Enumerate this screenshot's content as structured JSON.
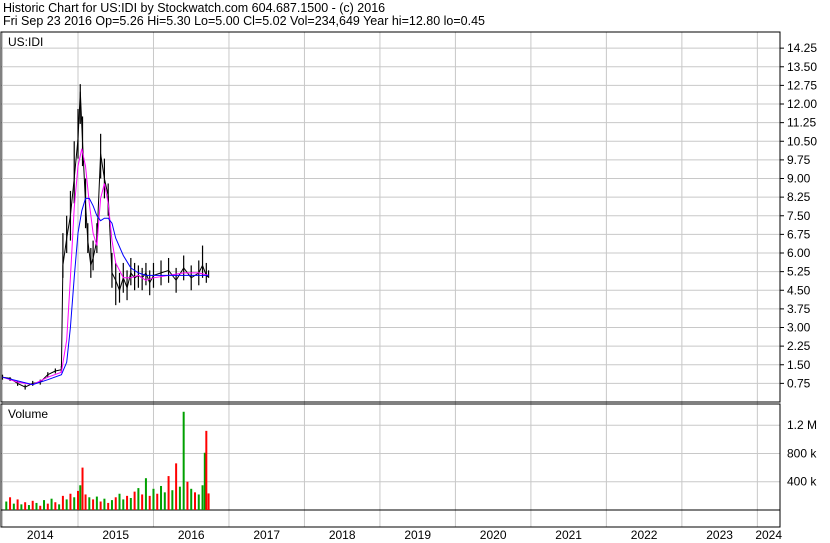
{
  "header": {
    "line1": "Historic Chart for US:IDI by Stockwatch.com 604.687.1500 - (c) 2016",
    "line2": "Fri Sep 23 2016   Op=5.26  Hi=5.30  Lo=5.00  Cl=5.02  Vol=234,649  Year hi=12.80  lo=0.45"
  },
  "chart_data": {
    "type": "line",
    "symbol_label": "US:IDI",
    "volume_label": "Volume",
    "price_axis": {
      "ticks": [
        "14.25",
        "13.50",
        "12.75",
        "12.00",
        "11.25",
        "10.50",
        "9.75",
        "9.00",
        "8.25",
        "7.50",
        "6.75",
        "6.00",
        "5.25",
        "4.50",
        "3.75",
        "3.00",
        "2.25",
        "1.50",
        "0.75"
      ],
      "ylim": [
        0.0,
        14.9
      ]
    },
    "volume_axis": {
      "ticks": [
        "1.2 M",
        "800 k",
        "400 k"
      ],
      "ylim": [
        0,
        1500000
      ]
    },
    "x_axis": {
      "labels": [
        "2014",
        "2015",
        "2016",
        "2017",
        "2018",
        "2019",
        "2020",
        "2021",
        "2022",
        "2023",
        "2024"
      ],
      "xlim": [
        2013.98,
        2024.3
      ]
    },
    "series": [
      {
        "color": "#000000",
        "x": [
          2014.0,
          2014.1,
          2014.2,
          2014.3,
          2014.4,
          2014.5,
          2014.6,
          2014.7,
          2014.78,
          2014.8,
          2014.85,
          2014.9,
          2014.95,
          2015.0,
          2015.03,
          2015.06,
          2015.1,
          2015.13,
          2015.17,
          2015.2,
          2015.25,
          2015.3,
          2015.35,
          2015.4,
          2015.45,
          2015.5,
          2015.55,
          2015.6,
          2015.65,
          2015.7,
          2015.75,
          2015.8,
          2015.85,
          2015.9,
          2015.95,
          2016.0,
          2016.1,
          2016.2,
          2016.3,
          2016.4,
          2016.5,
          2016.6,
          2016.65,
          2016.7,
          2016.73
        ],
        "close": [
          1.0,
          0.95,
          0.75,
          0.6,
          0.75,
          0.8,
          1.1,
          1.25,
          1.3,
          5.5,
          6.6,
          7.5,
          9.0,
          10.6,
          12.5,
          10.5,
          8.0,
          6.5,
          5.5,
          5.8,
          6.5,
          10.0,
          9.0,
          8.3,
          5.2,
          4.9,
          4.5,
          5.0,
          4.6,
          5.2,
          5.0,
          5.1,
          5.0,
          5.2,
          4.8,
          5.1,
          5.2,
          5.3,
          4.9,
          5.4,
          5.0,
          5.2,
          5.5,
          5.1,
          5.02
        ],
        "high": [
          1.1,
          1.0,
          0.85,
          0.7,
          0.85,
          0.9,
          1.2,
          1.35,
          1.45,
          6.8,
          7.5,
          8.5,
          10.5,
          11.8,
          12.8,
          11.5,
          9.0,
          7.2,
          6.2,
          6.5,
          7.2,
          10.8,
          9.8,
          8.8,
          6.0,
          5.6,
          5.2,
          5.6,
          5.3,
          5.8,
          5.6,
          5.5,
          5.4,
          5.6,
          5.3,
          5.6,
          5.7,
          5.8,
          5.4,
          5.9,
          5.5,
          5.7,
          6.3,
          5.6,
          5.3
        ],
        "low": [
          0.9,
          0.85,
          0.65,
          0.5,
          0.65,
          0.7,
          1.0,
          1.15,
          1.2,
          5.0,
          6.0,
          6.5,
          8.0,
          9.8,
          11.2,
          9.5,
          7.0,
          6.0,
          5.0,
          5.3,
          6.0,
          9.0,
          8.2,
          7.5,
          4.6,
          3.9,
          4.0,
          4.4,
          4.1,
          4.7,
          4.5,
          4.6,
          4.5,
          4.7,
          4.3,
          4.6,
          4.7,
          4.8,
          4.4,
          4.9,
          4.5,
          4.7,
          5.0,
          4.8,
          5.0
        ]
      },
      {
        "color": "#ff00ff",
        "x": [
          2014.0,
          2014.2,
          2014.4,
          2014.6,
          2014.78,
          2014.85,
          2014.9,
          2014.95,
          2015.0,
          2015.05,
          2015.1,
          2015.15,
          2015.2,
          2015.25,
          2015.3,
          2015.35,
          2015.4,
          2015.45,
          2015.5,
          2015.6,
          2015.7,
          2015.8,
          2015.9,
          2016.0,
          2016.2,
          2016.4,
          2016.6,
          2016.73
        ],
        "y": [
          1.0,
          0.8,
          0.7,
          1.0,
          1.2,
          2.5,
          5.0,
          7.8,
          9.5,
          10.2,
          9.5,
          8.0,
          6.8,
          6.3,
          8.2,
          8.8,
          8.0,
          6.5,
          5.6,
          5.0,
          5.0,
          5.1,
          4.9,
          5.0,
          5.1,
          5.2,
          5.2,
          5.1
        ]
      },
      {
        "color": "#0000ff",
        "x": [
          2014.0,
          2014.2,
          2014.4,
          2014.6,
          2014.78,
          2014.85,
          2014.9,
          2014.95,
          2015.0,
          2015.05,
          2015.1,
          2015.15,
          2015.2,
          2015.25,
          2015.3,
          2015.35,
          2015.4,
          2015.45,
          2015.5,
          2015.6,
          2015.7,
          2015.8,
          2015.9,
          2016.0,
          2016.2,
          2016.4,
          2016.6,
          2016.73
        ],
        "y": [
          1.0,
          0.85,
          0.7,
          0.9,
          1.1,
          1.6,
          3.0,
          5.0,
          6.8,
          7.7,
          8.2,
          8.2,
          7.9,
          7.5,
          7.3,
          7.4,
          7.4,
          7.2,
          6.6,
          5.9,
          5.4,
          5.2,
          5.1,
          5.1,
          5.1,
          5.1,
          5.1,
          5.1
        ]
      }
    ],
    "volume": {
      "up_color": "#00a000",
      "down_color": "#ff0000",
      "x": [
        2014.05,
        2014.1,
        2014.15,
        2014.2,
        2014.25,
        2014.3,
        2014.35,
        2014.4,
        2014.45,
        2014.5,
        2014.55,
        2014.6,
        2014.65,
        2014.7,
        2014.75,
        2014.8,
        2014.85,
        2014.9,
        2014.95,
        2015.0,
        2015.03,
        2015.06,
        2015.1,
        2015.15,
        2015.2,
        2015.25,
        2015.3,
        2015.35,
        2015.4,
        2015.45,
        2015.5,
        2015.55,
        2015.6,
        2015.65,
        2015.7,
        2015.75,
        2015.8,
        2015.85,
        2015.9,
        2015.95,
        2016.0,
        2016.05,
        2016.1,
        2016.15,
        2016.2,
        2016.25,
        2016.3,
        2016.35,
        2016.4,
        2016.45,
        2016.5,
        2016.55,
        2016.6,
        2016.65,
        2016.68,
        2016.7,
        2016.73
      ],
      "values": [
        120000,
        180000,
        90000,
        150000,
        80000,
        110000,
        70000,
        130000,
        100000,
        60000,
        140000,
        90000,
        160000,
        110000,
        80000,
        200000,
        150000,
        230000,
        180000,
        270000,
        350000,
        600000,
        220000,
        180000,
        150000,
        190000,
        120000,
        160000,
        100000,
        140000,
        180000,
        230000,
        150000,
        200000,
        170000,
        260000,
        310000,
        220000,
        450000,
        200000,
        300000,
        230000,
        340000,
        250000,
        480000,
        280000,
        660000,
        330000,
        1390000,
        400000,
        300000,
        250000,
        220000,
        350000,
        810000,
        1120000,
        234649
      ],
      "up": [
        true,
        false,
        true,
        false,
        true,
        false,
        true,
        false,
        true,
        false,
        true,
        false,
        true,
        false,
        true,
        false,
        true,
        false,
        true,
        false,
        true,
        false,
        false,
        true,
        false,
        true,
        false,
        true,
        false,
        true,
        false,
        true,
        true,
        false,
        true,
        false,
        true,
        false,
        true,
        false,
        true,
        false,
        true,
        true,
        false,
        true,
        false,
        true,
        true,
        false,
        true,
        false,
        true,
        true,
        true,
        false,
        false
      ]
    }
  }
}
